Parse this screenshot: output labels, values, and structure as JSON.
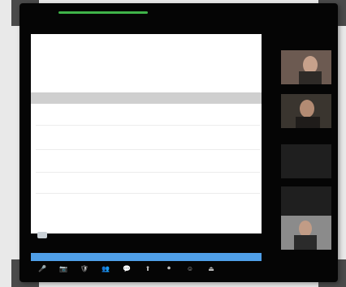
{
  "window": {
    "title": "",
    "topbar_title": "",
    "topbar_right": ""
  },
  "share": {
    "title": "",
    "search_text": "",
    "row_label_1": "",
    "row_label_2": "",
    "info_text": "",
    "blue_button": ""
  },
  "participants": [
    {
      "name": "",
      "label": ""
    },
    {
      "name": "",
      "label": ""
    },
    {
      "name": "",
      "label": ""
    },
    {
      "name": "",
      "label": ""
    },
    {
      "name": "",
      "label": ""
    }
  ],
  "toolbar": {
    "icons": [
      "microphone-icon",
      "video-icon",
      "security-icon",
      "participants-icon",
      "chat-icon",
      "share-screen-icon",
      "record-icon",
      "reactions-icon",
      "leave-icon"
    ]
  },
  "colors": {
    "frame": "#050505",
    "share_bg": "#ffffff",
    "blue_bar": "#4f9fe8",
    "green_pill": "#3fb349"
  }
}
